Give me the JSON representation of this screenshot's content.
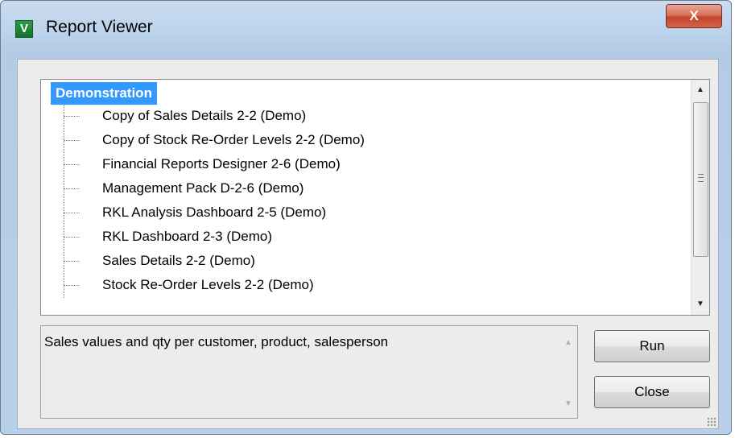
{
  "window": {
    "title": "Report Viewer",
    "icon_letter": "V",
    "close_label": "X"
  },
  "tree": {
    "root": "Demonstration",
    "items": [
      "Copy of Sales Details 2-2 (Demo)",
      "Copy of Stock Re-Order Levels 2-2 (Demo)",
      "Financial Reports Designer 2-6 (Demo)",
      "Management Pack D-2-6 (Demo)",
      "RKL Analysis Dashboard 2-5 (Demo)",
      "RKL Dashboard 2-3 (Demo)",
      "Sales Details 2-2 (Demo)",
      "Stock Re-Order Levels 2-2 (Demo)"
    ]
  },
  "description": "Sales values and qty per customer, product, salesperson",
  "buttons": {
    "run": "Run",
    "close": "Close"
  },
  "icons": [
    "app-icon",
    "close-icon",
    "scroll-up-icon",
    "scroll-down-icon",
    "grip-icon",
    "resize-grip-icon"
  ],
  "colors": {
    "selection": "#3399ff",
    "close_button": "#c4452b"
  }
}
